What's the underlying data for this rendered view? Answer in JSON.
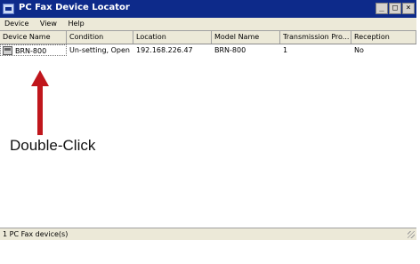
{
  "window": {
    "title": "PC Fax Device Locator",
    "buttons": [
      "_",
      "□",
      "×"
    ]
  },
  "menu": [
    "Device",
    "View",
    "Help"
  ],
  "table": {
    "columns": [
      "Device Name",
      "Condition",
      "Location",
      "Model Name",
      "Transmission Pro...",
      "Reception"
    ],
    "rows": [
      [
        "BRN-800",
        "Un-setting, Open",
        "192.168.226.47",
        "BRN-800",
        "1",
        "No"
      ]
    ]
  },
  "annotation": {
    "label": "Double-Click",
    "arrow_color": "#c0161c"
  },
  "status": {
    "text": "1 PC Fax device(s)"
  }
}
